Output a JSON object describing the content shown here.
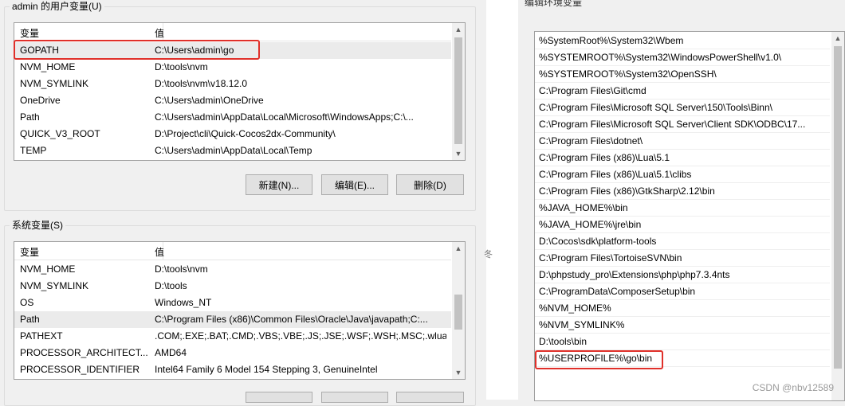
{
  "user_vars": {
    "title": "admin 的用户变量(U)",
    "col_name": "变量",
    "col_value": "值",
    "rows": [
      {
        "name": "GOPATH",
        "value": "C:\\Users\\admin\\go"
      },
      {
        "name": "NVM_HOME",
        "value": "D:\\tools\\nvm"
      },
      {
        "name": "NVM_SYMLINK",
        "value": "D:\\tools\\nvm\\v18.12.0"
      },
      {
        "name": "OneDrive",
        "value": "C:\\Users\\admin\\OneDrive"
      },
      {
        "name": "Path",
        "value": "C:\\Users\\admin\\AppData\\Local\\Microsoft\\WindowsApps;C:\\..."
      },
      {
        "name": "QUICK_V3_ROOT",
        "value": "D:\\Project\\cli\\Quick-Cocos2dx-Community\\"
      },
      {
        "name": "TEMP",
        "value": "C:\\Users\\admin\\AppData\\Local\\Temp"
      }
    ],
    "buttons": {
      "new": "新建(N)...",
      "edit": "编辑(E)...",
      "delete": "删除(D)"
    }
  },
  "system_vars": {
    "title": "系统变量(S)",
    "col_name": "变量",
    "col_value": "值",
    "rows": [
      {
        "name": "NVM_HOME",
        "value": "D:\\tools\\nvm"
      },
      {
        "name": "NVM_SYMLINK",
        "value": "D:\\tools"
      },
      {
        "name": "OS",
        "value": "Windows_NT"
      },
      {
        "name": "Path",
        "value": "C:\\Program Files (x86)\\Common Files\\Oracle\\Java\\javapath;C:..."
      },
      {
        "name": "PATHEXT",
        "value": ".COM;.EXE;.BAT;.CMD;.VBS;.VBE;.JS;.JSE;.WSF;.WSH;.MSC;.wlua..."
      },
      {
        "name": "PROCESSOR_ARCHITECT...",
        "value": "AMD64"
      },
      {
        "name": "PROCESSOR_IDENTIFIER",
        "value": "Intel64 Family 6 Model 154 Stepping 3, GenuineIntel"
      }
    ]
  },
  "edit_env": {
    "title": "编辑环境变量",
    "items": [
      "%SystemRoot%\\System32\\Wbem",
      "%SYSTEMROOT%\\System32\\WindowsPowerShell\\v1.0\\",
      "%SYSTEMROOT%\\System32\\OpenSSH\\",
      "C:\\Program Files\\Git\\cmd",
      "C:\\Program Files\\Microsoft SQL Server\\150\\Tools\\Binn\\",
      "C:\\Program Files\\Microsoft SQL Server\\Client SDK\\ODBC\\17...",
      "C:\\Program Files\\dotnet\\",
      "C:\\Program Files (x86)\\Lua\\5.1",
      "C:\\Program Files (x86)\\Lua\\5.1\\clibs",
      "C:\\Program Files (x86)\\GtkSharp\\2.12\\bin",
      "%JAVA_HOME%\\bin",
      "%JAVA_HOME%\\jre\\bin",
      "D:\\Cocos\\sdk\\platform-tools",
      "C:\\Program Files\\TortoiseSVN\\bin",
      "D:\\phpstudy_pro\\Extensions\\php\\php7.3.4nts",
      "C:\\ProgramData\\ComposerSetup\\bin",
      "%NVM_HOME%",
      "%NVM_SYMLINK%",
      "D:\\tools\\bin",
      "%USERPROFILE%\\go\\bin"
    ]
  },
  "edge_text": "冬",
  "watermark": "CSDN @nbv12589",
  "colors": {
    "highlight": "#e0302a",
    "selected_row": "#ebebeb"
  }
}
